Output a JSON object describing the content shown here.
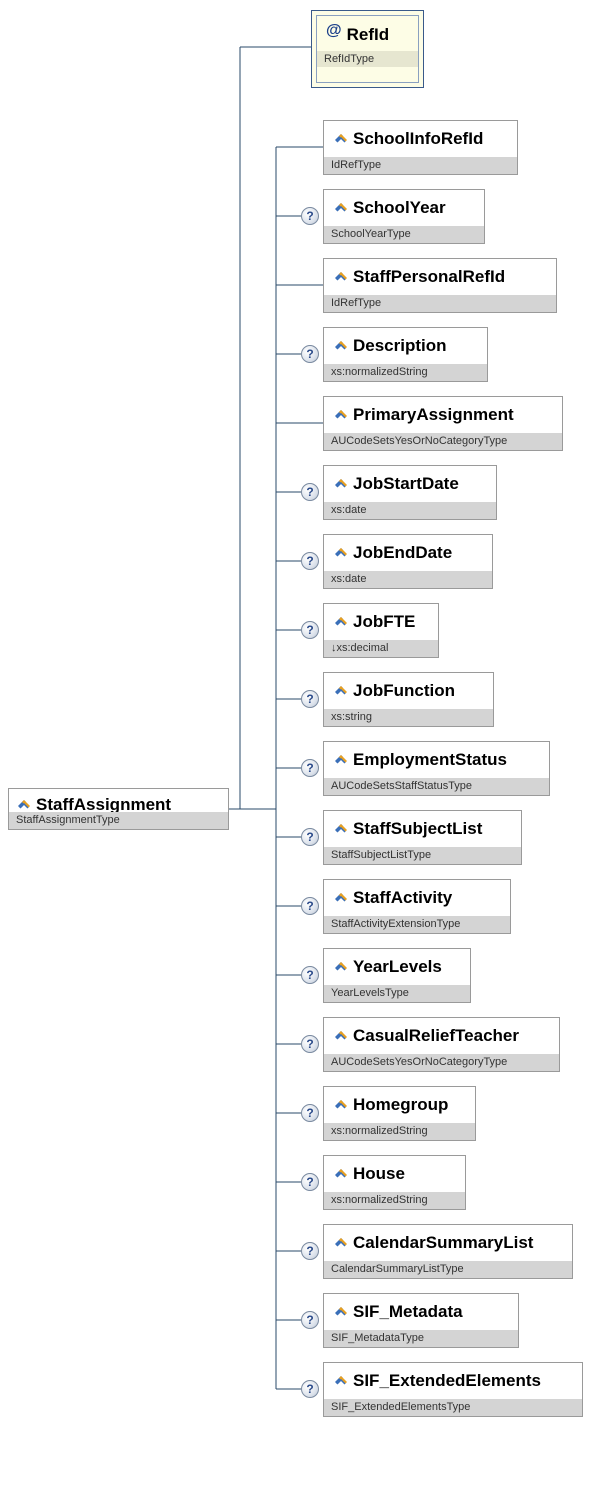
{
  "root": {
    "name": "StaffAssignment",
    "type": "StaffAssignmentType"
  },
  "attribute": {
    "symbol": "@",
    "name": "RefId",
    "type": "RefIdType"
  },
  "optional_symbol": "?",
  "elements": [
    {
      "name": "SchoolInfoRefId",
      "type": "IdRefType",
      "optional": false
    },
    {
      "name": "SchoolYear",
      "type": "SchoolYearType",
      "optional": true
    },
    {
      "name": "StaffPersonalRefId",
      "type": "IdRefType",
      "optional": false
    },
    {
      "name": "Description",
      "type": "xs:normalizedString",
      "optional": true
    },
    {
      "name": "PrimaryAssignment",
      "type": "AUCodeSetsYesOrNoCategoryType",
      "optional": false
    },
    {
      "name": "JobStartDate",
      "type": "xs:date",
      "optional": true
    },
    {
      "name": "JobEndDate",
      "type": "xs:date",
      "optional": true
    },
    {
      "name": "JobFTE",
      "type": "↓xs:decimal",
      "optional": true
    },
    {
      "name": "JobFunction",
      "type": "xs:string",
      "optional": true
    },
    {
      "name": "EmploymentStatus",
      "type": "AUCodeSetsStaffStatusType",
      "optional": true
    },
    {
      "name": "StaffSubjectList",
      "type": "StaffSubjectListType",
      "optional": true
    },
    {
      "name": "StaffActivity",
      "type": "StaffActivityExtensionType",
      "optional": true
    },
    {
      "name": "YearLevels",
      "type": "YearLevelsType",
      "optional": true
    },
    {
      "name": "CasualReliefTeacher",
      "type": "AUCodeSetsYesOrNoCategoryType",
      "optional": true
    },
    {
      "name": "Homegroup",
      "type": "xs:normalizedString",
      "optional": true
    },
    {
      "name": "House",
      "type": "xs:normalizedString",
      "optional": true
    },
    {
      "name": "CalendarSummaryList",
      "type": "CalendarSummaryListType",
      "optional": true
    },
    {
      "name": "SIF_Metadata",
      "type": "SIF_MetadataType",
      "optional": true
    },
    {
      "name": "SIF_ExtendedElements",
      "type": "SIF_ExtendedElementsType",
      "optional": true
    }
  ],
  "colors": {
    "line": "#2a4a6a",
    "type_band": "#d4d4d4",
    "icon_blue": "#3a6fb8",
    "icon_orange": "#e8a020"
  }
}
